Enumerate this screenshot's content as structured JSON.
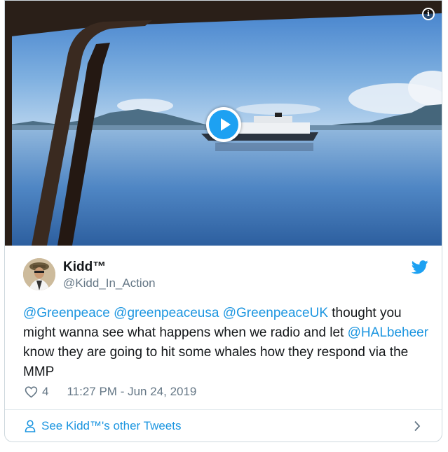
{
  "tweet": {
    "author_name": "Kidd™",
    "author_handle": "@Kidd_In_Action",
    "mentions": [
      "@Greenpeace",
      "@greenpeaceusa",
      "@GreenpeaceUK",
      "@HALbeheer"
    ],
    "text_parts": [
      " thought you might wanna see what happens when we radio and let ",
      " know they are going to hit some whales how they respond via the MMP"
    ],
    "likes": "4",
    "timestamp": "11:27 PM - Jun 24, 2019"
  },
  "footer": {
    "see_more_label": "See Kidd™'s other Tweets"
  },
  "media": {
    "info_glyph": "i"
  },
  "colors": {
    "accent": "#1b95e0",
    "twitter_blue": "#1da1f2",
    "muted": "#657786",
    "text": "#14171a"
  },
  "icons": [
    "info-icon",
    "play-icon",
    "twitter-bird-icon",
    "heart-icon",
    "person-icon",
    "chevron-right-icon"
  ]
}
